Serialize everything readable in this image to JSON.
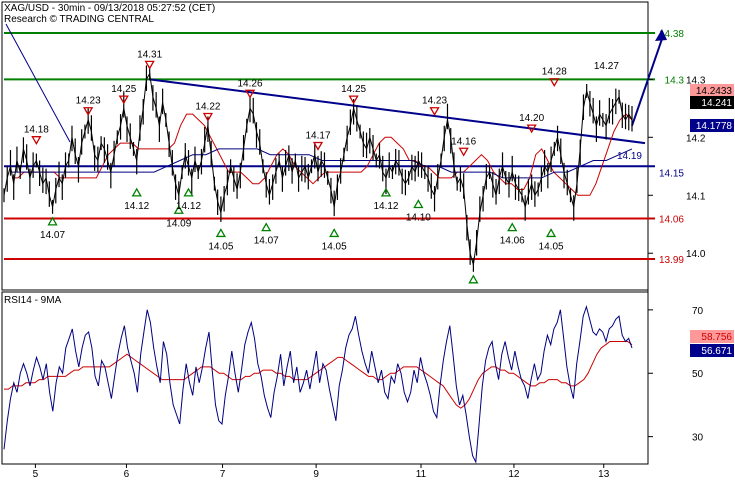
{
  "header": {
    "line1": "XAG/USD - 30min - 09/13/2018 05:27:52 (CET)",
    "line2": "Research © TRADING CENTRAL"
  },
  "colors": {
    "price": "#000000",
    "ma_fast": "#cc0000",
    "ma_slow": "#000080",
    "support": "#cc0000",
    "resistance": "#008000",
    "pivot": "#00008b",
    "trendline": "#00008b",
    "up_triangle": "#008000",
    "down_triangle": "#cc0000",
    "rsi": "#000080",
    "rsi_ma": "#cc0000"
  },
  "chart_data": [
    {
      "type": "line",
      "title": "XAG/USD - 30min - 09/13/2018 05:27:52 (CET)",
      "x_tick_labels": [
        "5",
        "6",
        "7",
        "9",
        "11",
        "12",
        "13"
      ],
      "y_tick_labels": [
        "14.3",
        "14.2",
        "14.1",
        "14.0"
      ],
      "ylim": [
        13.94,
        14.43
      ],
      "series": [
        {
          "kind": "price",
          "values": [
            14.1,
            14.13,
            14.15,
            14.12,
            14.16,
            14.14,
            14.18,
            14.16,
            14.13,
            14.15,
            14.16,
            14.14,
            14.12,
            14.13,
            14.1,
            14.08,
            14.11,
            14.13,
            14.12,
            14.15,
            14.16,
            14.2,
            14.17,
            14.15,
            14.19,
            14.21,
            14.23,
            14.21,
            14.17,
            14.16,
            14.19,
            14.18,
            14.16,
            14.14,
            14.17,
            14.2,
            14.22,
            14.25,
            14.22,
            14.2,
            14.18,
            14.16,
            14.21,
            14.25,
            14.3,
            14.31,
            14.27,
            14.25,
            14.22,
            14.26,
            14.23,
            14.19,
            14.15,
            14.12,
            14.1,
            14.14,
            14.17,
            14.15,
            14.13,
            14.16,
            14.14,
            14.16,
            14.19,
            14.22,
            14.17,
            14.12,
            14.09,
            14.07,
            14.1,
            14.12,
            14.15,
            14.13,
            14.11,
            14.14,
            14.18,
            14.22,
            14.25,
            14.24,
            14.21,
            14.19,
            14.15,
            14.12,
            14.1,
            14.12,
            14.14,
            14.16,
            14.13,
            14.15,
            14.17,
            14.14,
            14.16,
            14.13,
            14.14,
            14.15,
            14.13,
            14.15,
            14.17,
            14.14,
            14.16,
            14.15,
            14.13,
            14.11,
            14.08,
            14.12,
            14.14,
            14.17,
            14.2,
            14.22,
            14.25,
            14.23,
            14.21,
            14.19,
            14.18,
            14.2,
            14.18,
            14.16,
            14.17,
            14.14,
            14.13,
            14.15,
            14.14,
            14.16,
            14.15,
            14.13,
            14.12,
            14.13,
            14.15,
            14.14,
            14.16,
            14.15,
            14.14,
            14.13,
            14.11,
            14.1,
            14.13,
            14.16,
            14.2,
            14.23,
            14.2,
            14.15,
            14.12,
            14.13,
            14.11,
            14.05,
            14.0,
            13.98,
            14.02,
            14.07,
            14.1,
            14.13,
            14.14,
            14.12,
            14.1,
            14.13,
            14.15,
            14.13,
            14.12,
            14.14,
            14.12,
            14.11,
            14.1,
            14.08,
            14.1,
            14.12,
            14.1,
            14.11,
            14.13,
            14.15,
            14.14,
            14.16,
            14.18,
            14.2,
            14.17,
            14.14,
            14.12,
            14.1,
            14.08,
            14.12,
            14.18,
            14.25,
            14.28,
            14.26,
            14.24,
            14.22,
            14.24,
            14.23,
            14.22,
            14.24,
            14.25,
            14.26,
            14.27,
            14.24,
            14.23,
            14.24,
            14.23
          ]
        },
        {
          "kind": "ma-fast",
          "values": [
            14.13,
            14.13,
            14.14,
            14.14,
            14.14,
            14.14,
            14.14,
            14.14,
            14.13,
            14.13,
            14.13,
            14.13,
            14.13,
            14.13,
            14.13,
            14.15,
            14.17,
            14.18,
            14.19,
            14.19,
            14.19,
            14.18,
            14.18,
            14.18,
            14.18,
            14.18,
            14.18,
            14.19,
            14.22,
            14.24,
            14.24,
            14.23,
            14.22,
            14.2,
            14.18,
            14.16,
            14.14,
            14.14,
            14.14,
            14.13,
            14.12,
            14.12,
            14.13,
            14.15,
            14.17,
            14.18,
            14.17,
            14.15,
            14.14,
            14.13,
            14.12,
            14.13,
            14.14,
            14.14,
            14.14,
            14.14,
            14.14,
            14.14,
            14.14,
            14.15,
            14.17,
            14.19,
            14.2,
            14.2,
            14.19,
            14.18,
            14.16,
            14.16,
            14.15,
            14.15,
            14.14,
            14.13,
            14.13,
            14.13,
            14.14,
            14.14,
            14.15,
            14.16,
            14.17,
            14.16,
            14.14,
            14.13,
            14.12,
            14.12,
            14.11,
            14.11,
            14.13,
            14.17,
            14.18,
            14.16,
            14.14,
            14.13,
            14.12,
            14.11,
            14.1,
            14.1,
            14.1,
            14.12,
            14.15,
            14.18,
            14.21,
            14.23,
            14.24,
            14.23
          ]
        },
        {
          "kind": "ma-slow",
          "values": [
            14.14,
            14.14,
            14.14,
            14.14,
            14.14,
            14.14,
            14.14,
            14.14,
            14.14,
            14.14,
            14.14,
            14.14,
            14.15,
            14.16,
            14.17,
            14.17,
            14.18,
            14.18,
            14.18,
            14.18,
            14.17,
            14.17,
            14.17,
            14.17,
            14.16,
            14.16,
            14.16,
            14.16,
            14.16,
            14.16,
            14.16,
            14.16,
            14.15,
            14.15,
            14.14,
            14.14,
            14.14,
            14.14,
            14.13,
            14.13,
            14.13,
            14.13,
            14.14,
            14.14,
            14.15,
            14.16,
            14.16,
            14.17,
            14.18
          ]
        }
      ],
      "resistance_levels": [
        {
          "value": 14.38,
          "label": "14.38"
        },
        {
          "value": 14.3,
          "label": "14.3"
        }
      ],
      "support_levels": [
        {
          "value": 14.06,
          "label": "14.06"
        },
        {
          "value": 13.99,
          "label": "13.99"
        }
      ],
      "pivot": {
        "value": 14.15,
        "label": "14.15"
      },
      "trendline": {
        "from": 14.3,
        "to": 14.19,
        "label": "14.19"
      },
      "projection_arrow": {
        "from": 14.22,
        "to": 14.38
      },
      "current_price_tags": [
        {
          "label": "14.2433"
        },
        {
          "label": "14.241"
        },
        {
          "label": "14.1778"
        }
      ],
      "swing_highs": [
        {
          "index": 10,
          "value": 14.17,
          "label": "14.18"
        },
        {
          "index": 26,
          "value": 14.22,
          "label": "14.23"
        },
        {
          "index": 37,
          "value": 14.24,
          "label": "14.25"
        },
        {
          "index": 45,
          "value": 14.3,
          "label": "14.31"
        },
        {
          "index": 63,
          "value": 14.21,
          "label": "14.22"
        },
        {
          "index": 76,
          "value": 14.25,
          "label": "14.26"
        },
        {
          "index": 97,
          "value": 14.16,
          "label": "14.17"
        },
        {
          "index": 108,
          "value": 14.24,
          "label": "14.25"
        },
        {
          "index": 133,
          "value": 14.22,
          "label": "14.23"
        },
        {
          "index": 142,
          "value": 14.15,
          "label": "14.16"
        },
        {
          "index": 163,
          "value": 14.19,
          "label": "14.20"
        },
        {
          "index": 170,
          "value": 14.27,
          "label": "14.28"
        }
      ],
      "swing_lows": [
        {
          "index": 15,
          "value": 14.08,
          "label": "14.07"
        },
        {
          "index": 41,
          "value": 14.13,
          "label": "14.12"
        },
        {
          "index": 54,
          "value": 14.1,
          "label": "14.09"
        },
        {
          "index": 57,
          "value": 14.13,
          "label": "14.12"
        },
        {
          "index": 67,
          "value": 14.06,
          "label": "14.05"
        },
        {
          "index": 81,
          "value": 14.07,
          "label": "14.07"
        },
        {
          "index": 102,
          "value": 14.06,
          "label": "14.05"
        },
        {
          "index": 118,
          "value": 14.13,
          "label": "14.12"
        },
        {
          "index": 128,
          "value": 14.11,
          "label": "14.10"
        },
        {
          "index": 145,
          "value": 13.98,
          "label": ""
        },
        {
          "index": 157,
          "value": 14.07,
          "label": "14.06"
        },
        {
          "index": 169,
          "value": 14.06,
          "label": "14.05"
        }
      ],
      "extra_labels": [
        {
          "index": 183,
          "value": 14.29,
          "label": "14.27"
        }
      ]
    },
    {
      "type": "line",
      "title": "RSI14 - 9MA",
      "y_tick_labels": [
        "70",
        "50",
        "30"
      ],
      "ylim": [
        22,
        75
      ],
      "current_value_tags": [
        {
          "label": "58.756"
        },
        {
          "label": "56.671"
        }
      ],
      "series": [
        {
          "kind": "rsi",
          "values": [
            26,
            35,
            42,
            47,
            44,
            50,
            53,
            50,
            46,
            51,
            55,
            52,
            48,
            53,
            44,
            38,
            47,
            52,
            50,
            58,
            61,
            64,
            57,
            52,
            58,
            62,
            63,
            58,
            49,
            46,
            54,
            52,
            47,
            42,
            49,
            56,
            61,
            65,
            58,
            54,
            50,
            44,
            56,
            63,
            70,
            66,
            58,
            52,
            47,
            60,
            56,
            47,
            40,
            37,
            34,
            45,
            53,
            47,
            43,
            52,
            47,
            52,
            58,
            63,
            51,
            40,
            35,
            34,
            43,
            49,
            57,
            50,
            44,
            51,
            59,
            63,
            66,
            61,
            53,
            49,
            43,
            39,
            36,
            44,
            49,
            56,
            46,
            52,
            57,
            47,
            52,
            44,
            47,
            51,
            45,
            51,
            57,
            47,
            53,
            51,
            45,
            40,
            35,
            46,
            51,
            58,
            62,
            64,
            68,
            62,
            57,
            53,
            50,
            57,
            52,
            47,
            51,
            44,
            42,
            49,
            47,
            53,
            50,
            44,
            41,
            44,
            51,
            47,
            55,
            50,
            47,
            43,
            38,
            36,
            46,
            54,
            60,
            65,
            56,
            46,
            40,
            43,
            37,
            30,
            24,
            22,
            34,
            46,
            54,
            58,
            60,
            53,
            48,
            56,
            60,
            55,
            51,
            57,
            52,
            48,
            46,
            42,
            48,
            53,
            48,
            50,
            57,
            62,
            59,
            64,
            66,
            70,
            61,
            52,
            46,
            42,
            53,
            60,
            68,
            71,
            67,
            63,
            62,
            64,
            63,
            60,
            64,
            65,
            67,
            68,
            62,
            60,
            61,
            58
          ]
        },
        {
          "kind": "rsi-ma",
          "values": [
            45,
            45,
            46,
            46,
            46,
            47,
            47,
            47,
            48,
            48,
            49,
            49,
            49,
            49,
            49,
            50,
            51,
            51,
            52,
            52,
            52,
            52,
            52,
            52,
            52,
            53,
            54,
            55,
            56,
            55,
            54,
            53,
            52,
            51,
            50,
            49,
            48,
            48,
            48,
            48,
            48,
            48,
            49,
            50,
            51,
            52,
            52,
            52,
            51,
            50,
            50,
            49,
            48,
            48,
            48,
            49,
            49,
            50,
            50,
            51,
            51,
            51,
            50,
            50,
            49,
            49,
            48,
            48,
            48,
            48,
            49,
            50,
            51,
            52,
            53,
            54,
            55,
            55,
            54,
            53,
            52,
            51,
            50,
            49,
            49,
            48,
            48,
            49,
            50,
            50,
            51,
            52,
            52,
            52,
            52,
            51,
            50,
            49,
            48,
            47,
            46,
            44,
            42,
            40,
            39,
            40,
            42,
            45,
            48,
            50,
            51,
            52,
            52,
            51,
            51,
            50,
            50,
            49,
            48,
            47,
            46,
            46,
            47,
            47,
            48,
            48,
            48,
            47,
            47,
            46,
            46,
            47,
            48,
            50,
            53,
            56,
            58,
            59,
            60,
            60,
            60,
            60,
            60,
            59
          ]
        }
      ]
    }
  ]
}
